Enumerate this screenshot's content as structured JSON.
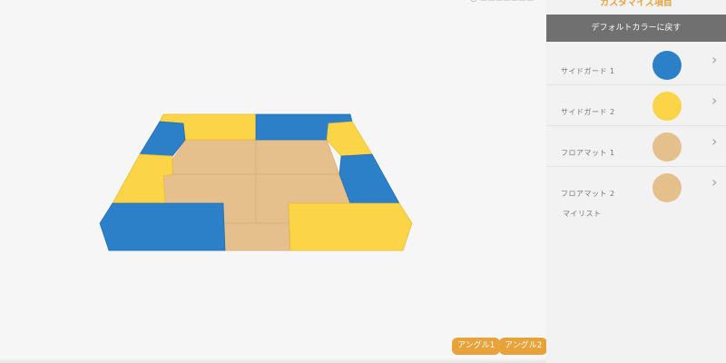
{
  "header": {
    "top_partial": "◎ ▬▬▬▬▬▬▬"
  },
  "panel": {
    "title": "カスタマイズ項目",
    "reset_label": "デフォルトカラーに戻す",
    "items": [
      {
        "label": "サイドガード 1",
        "color": "#2c80c8",
        "chevron": "chevron-right-icon"
      },
      {
        "label": "サイドガード 2",
        "color": "#fcd447",
        "chevron": "chevron-right-icon"
      },
      {
        "label": "フロアマット 1",
        "color": "#e5c08c",
        "chevron": "chevron-right-icon"
      },
      {
        "label": "フロアマット 2",
        "color": "#e5c08c",
        "chevron": "chevron-right-icon"
      }
    ],
    "mylist_label": "マイリスト"
  },
  "view": {
    "angle1_label": "アングル1",
    "angle2_label": "アングル2"
  },
  "colors": {
    "blue": "#2c80c8",
    "yellow": "#fcd447",
    "floor": "#e5c08c",
    "accent": "#e8a23a",
    "reset_bg": "#707070"
  }
}
